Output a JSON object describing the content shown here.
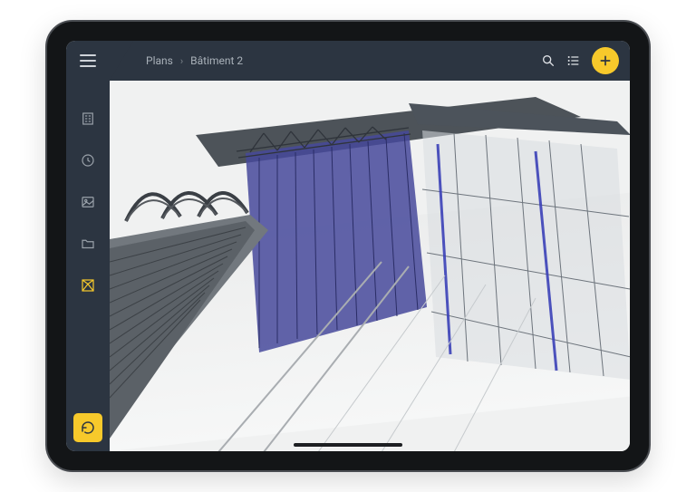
{
  "colors": {
    "accent": "#f7c92b",
    "sidebar_bg": "#2c3541",
    "muted_text": "#a9b1b9"
  },
  "header": {
    "breadcrumb": {
      "root": "Plans",
      "current": "Bâtiment 2"
    },
    "actions": {
      "search": "search-icon",
      "list": "list-icon",
      "add": "add-icon"
    }
  },
  "sidebar": {
    "items": [
      {
        "name": "building-icon",
        "active": false
      },
      {
        "name": "clock-icon",
        "active": false
      },
      {
        "name": "image-icon",
        "active": false
      },
      {
        "name": "folder-icon",
        "active": false
      },
      {
        "name": "bim-view-icon",
        "active": true
      }
    ],
    "bottom_action": "refresh-icon"
  },
  "viewport": {
    "model_name": "Bâtiment 2",
    "view_type": "3D BIM model"
  }
}
